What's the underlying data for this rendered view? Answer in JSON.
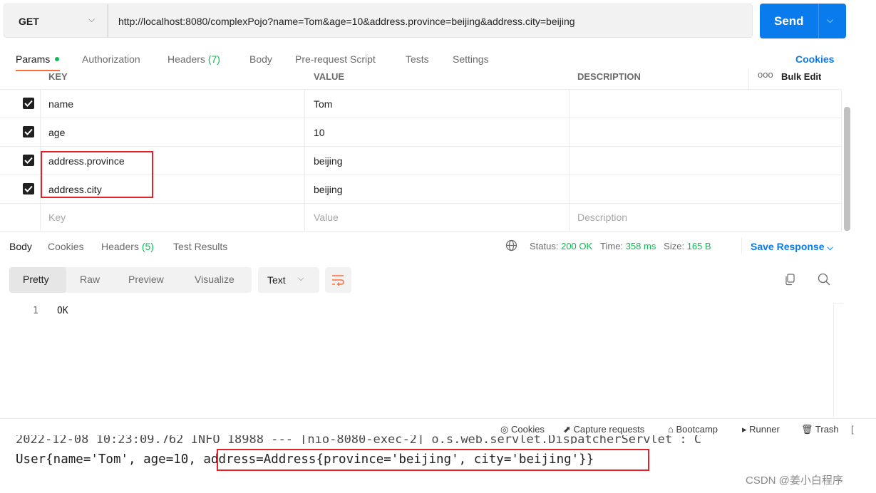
{
  "request": {
    "method": "GET",
    "url": "http://localhost:8080/complexPojo?name=Tom&age=10&address.province=beijing&address.city=beijing",
    "send_label": "Send"
  },
  "tabs": {
    "params": "Params",
    "authorization": "Authorization",
    "headers": "Headers",
    "headers_count": "(7)",
    "body": "Body",
    "pre_request": "Pre-request Script",
    "tests": "Tests",
    "settings": "Settings",
    "cookies": "Cookies"
  },
  "params_table": {
    "headers": {
      "key": "KEY",
      "value": "VALUE",
      "description": "DESCRIPTION",
      "more": "ooo",
      "bulk_edit": "Bulk Edit"
    },
    "rows": [
      {
        "key": "name",
        "value": "Tom",
        "checked": true
      },
      {
        "key": "age",
        "value": "10",
        "checked": true
      },
      {
        "key": "address.province",
        "value": "beijing",
        "checked": true
      },
      {
        "key": "address.city",
        "value": "beijing",
        "checked": true
      }
    ],
    "placeholders": {
      "key": "Key",
      "value": "Value",
      "description": "Description"
    }
  },
  "response": {
    "tabs": {
      "body": "Body",
      "cookies": "Cookies",
      "headers": "Headers",
      "headers_count": "(5)",
      "test_results": "Test Results"
    },
    "status_label": "Status:",
    "status_value": "200 OK",
    "time_label": "Time:",
    "time_value": "358 ms",
    "size_label": "Size:",
    "size_value": "165 B",
    "save_response": "Save Response",
    "views": {
      "pretty": "Pretty",
      "raw": "Raw",
      "preview": "Preview",
      "visualize": "Visualize"
    },
    "format": "Text",
    "line_number": "1",
    "body_text": "OK"
  },
  "statusbar": {
    "cookies": "Cookies",
    "capture": "Capture requests",
    "bootcamp": "Bootcamp",
    "runner": "Runner",
    "trash": "Trash"
  },
  "console": {
    "cut_line": "2022-12-08 10:23:09.762  INFO 18988 --- [nio-8080-exec-2] o.s.web.servlet.DispatcherServlet        : C",
    "prefix": "User{name='Tom', age=10, ",
    "highlight": "address=Address{province='beijing', city='beijing'}",
    "suffix": "}"
  },
  "watermark": "CSDN @姜小白程序",
  "colors": {
    "accent": "#097bed",
    "orange": "#ff6c37",
    "green": "#0cbb52",
    "highlight_red": "#e0232a"
  }
}
